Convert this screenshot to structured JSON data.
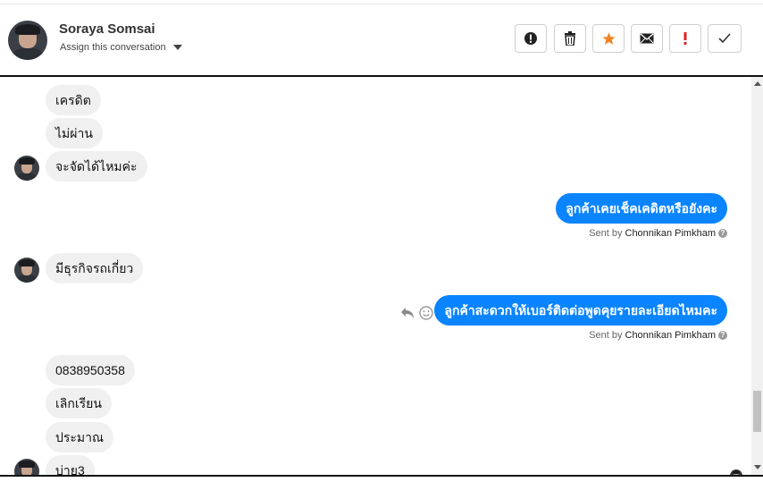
{
  "header": {
    "contact_name": "Soraya Somsai",
    "assign_label": "Assign this conversation",
    "actions": [
      {
        "name": "spam-button",
        "icon": "exclamation-circle-icon"
      },
      {
        "name": "delete-button",
        "icon": "trash-icon"
      },
      {
        "name": "star-button",
        "icon": "star-icon",
        "color": "#f5821f"
      },
      {
        "name": "email-button",
        "icon": "envelope-icon"
      },
      {
        "name": "important-button",
        "icon": "exclamation-mark-icon",
        "color": "#d9262a"
      },
      {
        "name": "done-button",
        "icon": "checkmark-icon"
      }
    ]
  },
  "messages": {
    "m1": "เครดิต",
    "m2": "ไม่ผ่าน",
    "m3": "จะจัดได้ไหมค่ะ",
    "out1": "ลูกค้าเคยเช็คเคดิตหรือยังคะ",
    "sent_prefix": "Sent by",
    "sender": "Chonnikan Pimkham",
    "m4": "มีธุรกิจรถเกี่ยว",
    "out2": "ลูกค้าสะดวกให้เบอร์ติดต่อพูดคุยรายละเอียดไหมคะ",
    "m5": "0838950358",
    "m6": "เลิกเรียน",
    "m7": "ประมาณ",
    "m8": "บ่าย3"
  },
  "colors": {
    "outgoing_bubble": "#0a84ff",
    "incoming_bubble": "#f0f0f0"
  }
}
